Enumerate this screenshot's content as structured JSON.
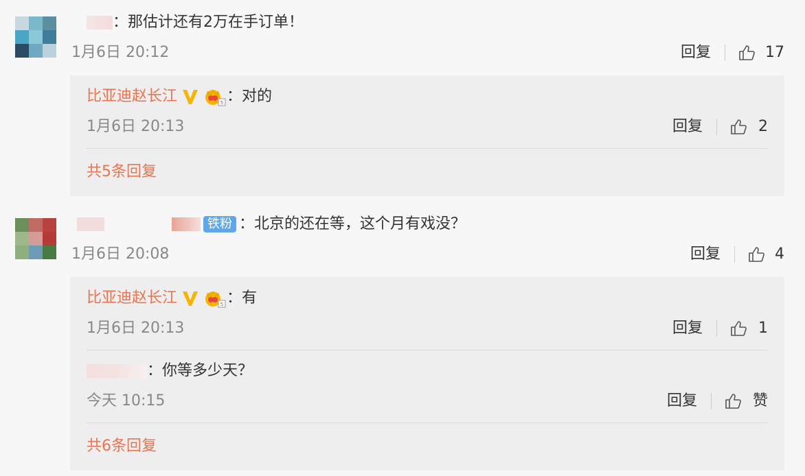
{
  "comments": [
    {
      "author_redacted": true,
      "text": "：那估计还有2万在手订单！",
      "time": "1月6日 20:12",
      "reply_label": "回复",
      "likes": "17",
      "avatar_colors": [
        "#c9d8de",
        "#7ab8cc",
        "#5a8ea0",
        "#4aa6c4",
        "#8cc9d8",
        "#3f7d9a",
        "#2d4a63",
        "#6fa8c0",
        "#b9d2dc"
      ],
      "subs": [
        {
          "author": "比亚迪赵长江",
          "text": "：对的",
          "time": "1月6日 20:13",
          "reply_label": "回复",
          "likes": "2"
        }
      ],
      "more_label": "共5条回复"
    },
    {
      "author_redacted": true,
      "fan_badge": "铁粉",
      "text": "：北京的还在等，这个月有戏没？",
      "time": "1月6日 20:08",
      "reply_label": "回复",
      "likes": "4",
      "avatar_colors": [
        "#6a8f5a",
        "#c26b64",
        "#b8423e",
        "#9eb88c",
        "#d39c96",
        "#b33a35",
        "#8fb07e",
        "#6b9bb5",
        "#4a7a44"
      ],
      "subs": [
        {
          "author": "比亚迪赵长江",
          "text": "：有",
          "time": "1月6日 20:13",
          "reply_label": "回复",
          "likes": "1"
        },
        {
          "author_redacted": true,
          "text": "：你等多少天？",
          "time": "今天 10:15",
          "reply_label": "回复",
          "likes": "赞"
        }
      ],
      "more_label": "共6条回复"
    }
  ],
  "icons": {
    "like": "thumbs-up-icon",
    "verified": "verified-v-icon",
    "crown": "crown-badge-icon"
  },
  "colors": {
    "accent": "#eb7350",
    "verified": "#f7b500",
    "fan_badge": "#5fa7e8"
  }
}
